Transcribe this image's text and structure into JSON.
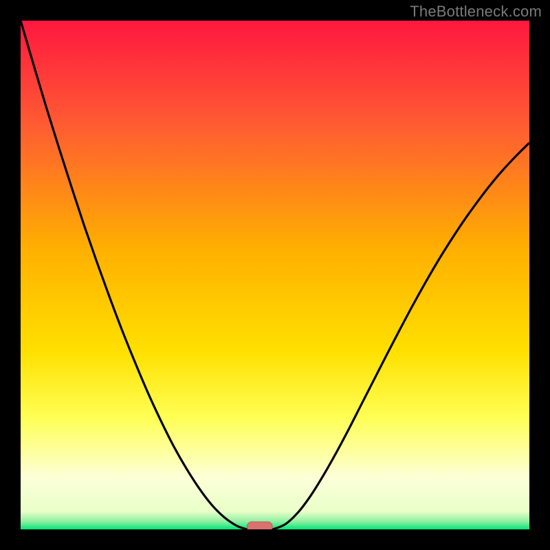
{
  "watermark": "TheBottleneck.com",
  "colors": {
    "background": "#000000",
    "gradient_top": "#ff173f",
    "gradient_mid1": "#ff7a2a",
    "gradient_mid2": "#ffd400",
    "gradient_mid3": "#ffff66",
    "gradient_mid4": "#fdffd0",
    "gradient_bottom": "#00e676",
    "curve": "#000000",
    "marker_fill": "#d9716f",
    "marker_stroke": "#c65a58"
  },
  "chart_data": {
    "type": "line",
    "title": "",
    "xlabel": "",
    "ylabel": "",
    "xlim": [
      0,
      1
    ],
    "ylim": [
      0,
      1
    ],
    "series": [
      {
        "name": "left-branch",
        "x": [
          0.0,
          0.025,
          0.05,
          0.075,
          0.1,
          0.125,
          0.15,
          0.175,
          0.2,
          0.225,
          0.25,
          0.275,
          0.3,
          0.325,
          0.35,
          0.375,
          0.4,
          0.425,
          0.445,
          0.45
        ],
        "values": [
          1.0,
          0.915,
          0.831,
          0.751,
          0.673,
          0.597,
          0.525,
          0.456,
          0.39,
          0.328,
          0.269,
          0.215,
          0.165,
          0.121,
          0.082,
          0.049,
          0.024,
          0.007,
          0.0,
          0.0
        ]
      },
      {
        "name": "right-branch",
        "x": [
          0.49,
          0.495,
          0.52,
          0.545,
          0.57,
          0.595,
          0.62,
          0.645,
          0.67,
          0.695,
          0.72,
          0.745,
          0.77,
          0.795,
          0.82,
          0.845,
          0.87,
          0.895,
          0.92,
          0.945,
          0.97,
          1.0
        ],
        "values": [
          0.0,
          0.0,
          0.01,
          0.033,
          0.066,
          0.106,
          0.15,
          0.197,
          0.246,
          0.295,
          0.344,
          0.392,
          0.439,
          0.484,
          0.527,
          0.567,
          0.605,
          0.64,
          0.673,
          0.703,
          0.73,
          0.76
        ]
      }
    ],
    "marker": {
      "x_center": 0.47,
      "x_halfwidth": 0.025,
      "y": 0.0
    },
    "gradient_stops": [
      {
        "offset": 0.0,
        "color": "#ff173f"
      },
      {
        "offset": 0.2,
        "color": "#ff5a33"
      },
      {
        "offset": 0.45,
        "color": "#ffb000"
      },
      {
        "offset": 0.65,
        "color": "#ffe000"
      },
      {
        "offset": 0.78,
        "color": "#ffff55"
      },
      {
        "offset": 0.9,
        "color": "#fcffd8"
      },
      {
        "offset": 0.965,
        "color": "#e9ffc8"
      },
      {
        "offset": 0.985,
        "color": "#8bf0a0"
      },
      {
        "offset": 1.0,
        "color": "#00e676"
      }
    ]
  }
}
